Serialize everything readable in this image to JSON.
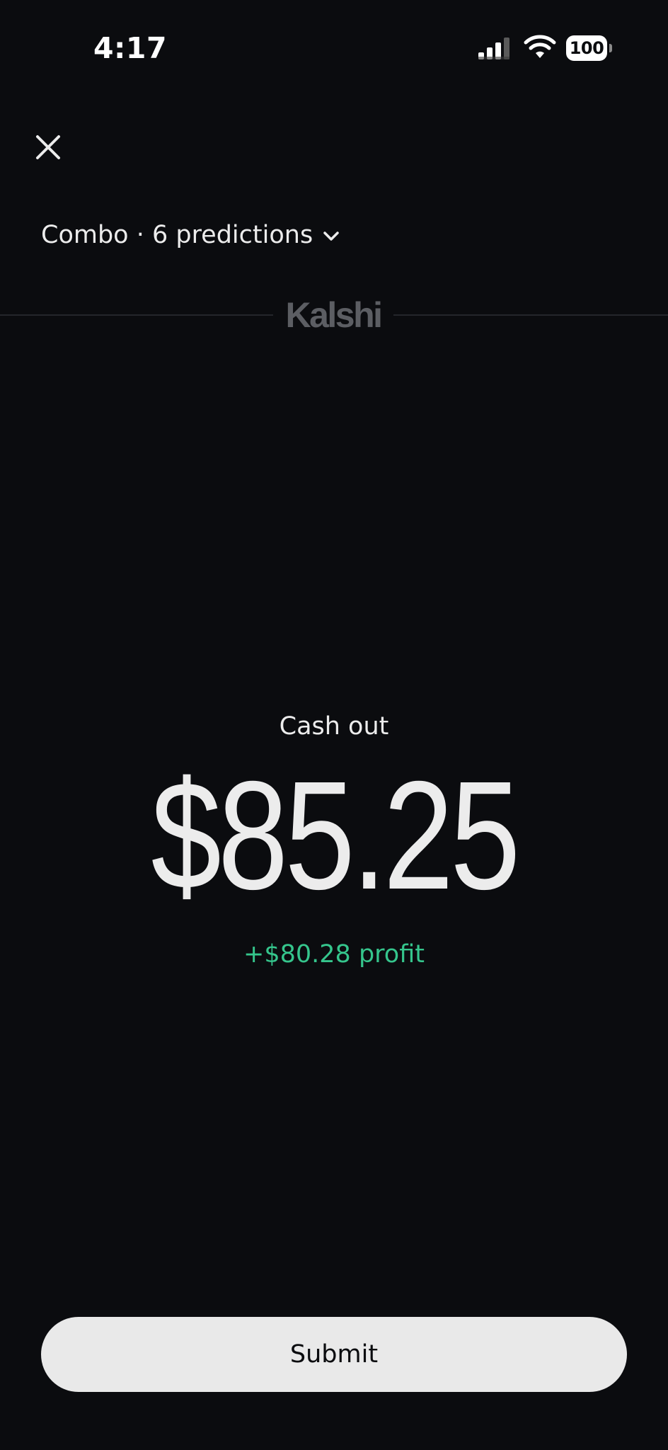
{
  "status_bar": {
    "time": "4:17",
    "battery_level": "100",
    "icons": [
      "signal-icon",
      "wifi-icon",
      "battery-icon"
    ]
  },
  "header": {
    "close_icon": "close-icon",
    "combo_label": "Combo · 6 predictions",
    "combo_chevron_icon": "chevron-down-icon"
  },
  "brand": {
    "name": "Kalshi"
  },
  "cashout": {
    "title": "Cash out",
    "amount": "$85.25",
    "profit": "+$80.28 profit"
  },
  "actions": {
    "submit_label": "Submit"
  },
  "colors": {
    "background": "#0b0c0f",
    "text": "#ececec",
    "profit_green": "#35c58c",
    "button_bg": "#e9e9e9",
    "brand_gray": "#5c5e63"
  }
}
